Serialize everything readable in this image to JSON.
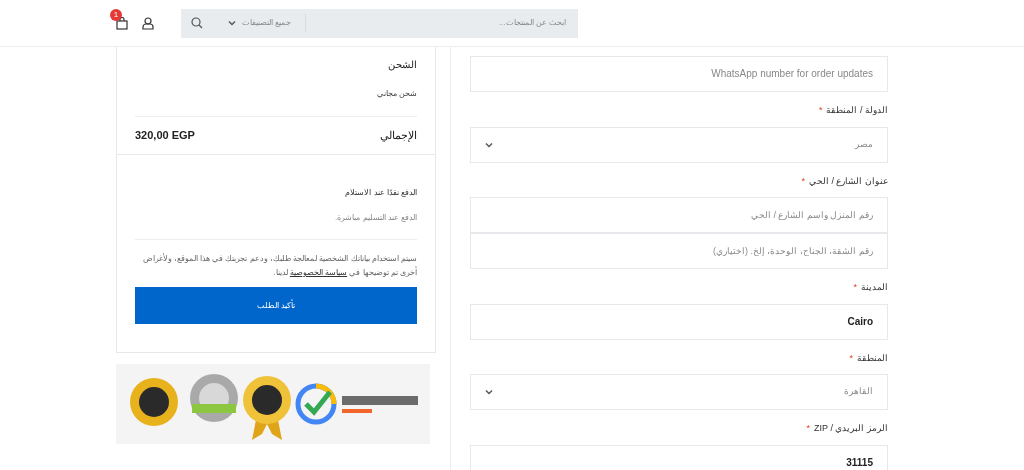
{
  "header": {
    "cart_count": "1",
    "search": {
      "placeholder": "ابحث عن المنتجات...",
      "category": "جميع التصنيفات"
    }
  },
  "summary": {
    "shipping_title": "الشحن",
    "shipping_value": "شحن مجاني",
    "total_label": "الإجمالي",
    "total_value": "320,00 EGP"
  },
  "payment": {
    "method": "الدفع نقدًا عند الاستلام",
    "description": "الدفع عند التسليم مباشرة.",
    "privacy_before": "سيتم استخدام بياناتك الشخصية لمعالجة طلبك، ودعم تجربتك في هذا الموقع، ولأغراض أخرى تم توضيحها في ",
    "privacy_link": "سياسة الخصوصية",
    "privacy_after": " لدينا.",
    "button": "تأكيد الطلب"
  },
  "form": [
    {
      "kind": "input",
      "placeholder": "WhatsApp number for order updates"
    },
    {
      "kind": "select",
      "label": "الدولة / المنطقة",
      "required_mark": "*",
      "value": "مصر"
    },
    {
      "kind": "input",
      "label": "عنوان الشارع / الحي",
      "required_mark": "*",
      "placeholder": "رقم المنزل واسم الشارع / الحي"
    },
    {
      "kind": "input",
      "placeholder": "رقم الشقة، الجناح، الوحدة، إلخ. (اختياري)"
    },
    {
      "kind": "input",
      "label": "المدينة",
      "required_mark": "*",
      "value": "Cairo"
    },
    {
      "kind": "select",
      "label": "المنطقة",
      "required_mark": "*",
      "value": "القاهرة"
    },
    {
      "kind": "input",
      "label": "الرمز البريدي / ZIP",
      "required_mark": "*",
      "value": "31115"
    }
  ]
}
